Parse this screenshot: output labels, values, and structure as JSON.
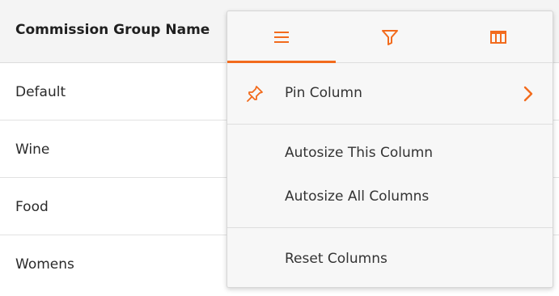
{
  "grid": {
    "header": {
      "column_name": "Commission Group Name"
    },
    "rows": [
      {
        "name": "Default"
      },
      {
        "name": "Wine"
      },
      {
        "name": "Food"
      },
      {
        "name": "Womens"
      }
    ]
  },
  "column_menu": {
    "tabs": [
      {
        "icon": "menu-icon",
        "active": true
      },
      {
        "icon": "filter-icon",
        "active": false
      },
      {
        "icon": "columns-icon",
        "active": false
      }
    ],
    "items": {
      "pin_column": {
        "label": "Pin Column",
        "icon": "pin-icon",
        "submenu_icon": "chevron-right-icon"
      },
      "autosize_this": {
        "label": "Autosize This Column"
      },
      "autosize_all": {
        "label": "Autosize All Columns"
      },
      "reset_columns": {
        "label": "Reset Columns"
      }
    }
  },
  "colors": {
    "accent": "#f26b1d",
    "header_bg": "#f4f4f4",
    "menu_bg": "#f7f7f7"
  }
}
